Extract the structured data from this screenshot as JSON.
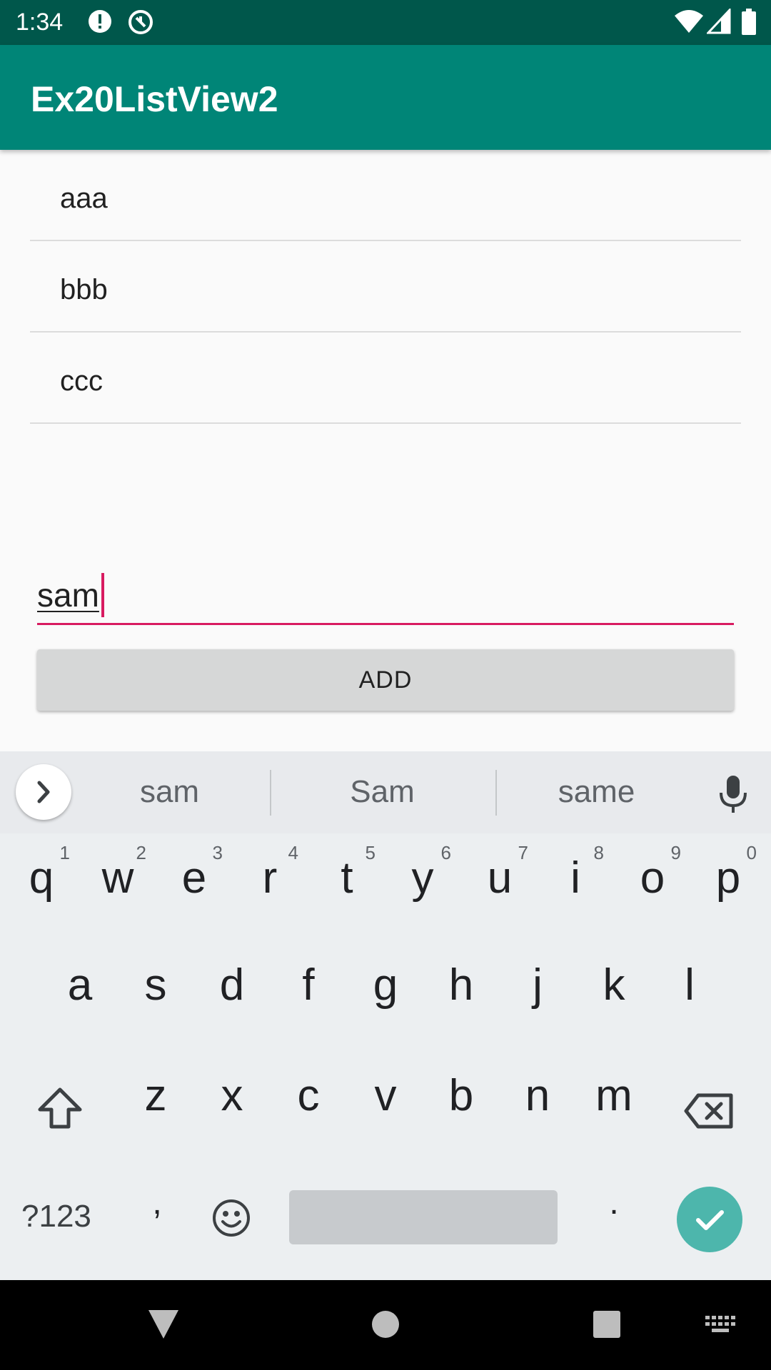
{
  "status_bar": {
    "time": "1:34"
  },
  "app_bar": {
    "title": "Ex20ListView2"
  },
  "list": {
    "items": [
      "aaa",
      "bbb",
      "ccc"
    ]
  },
  "input": {
    "value": "sam"
  },
  "add_button": {
    "label": "ADD"
  },
  "keyboard": {
    "suggestions": [
      "sam",
      "Sam",
      "same"
    ],
    "row1": [
      {
        "key": "q",
        "num": "1"
      },
      {
        "key": "w",
        "num": "2"
      },
      {
        "key": "e",
        "num": "3"
      },
      {
        "key": "r",
        "num": "4"
      },
      {
        "key": "t",
        "num": "5"
      },
      {
        "key": "y",
        "num": "6"
      },
      {
        "key": "u",
        "num": "7"
      },
      {
        "key": "i",
        "num": "8"
      },
      {
        "key": "o",
        "num": "9"
      },
      {
        "key": "p",
        "num": "0"
      }
    ],
    "row2": [
      "a",
      "s",
      "d",
      "f",
      "g",
      "h",
      "j",
      "k",
      "l"
    ],
    "row3": [
      "z",
      "x",
      "c",
      "v",
      "b",
      "n",
      "m"
    ],
    "symbols_label": "?123",
    "comma": ",",
    "period": "."
  },
  "colors": {
    "status_bar": "#00574b",
    "app_bar": "#008577",
    "accent": "#d81b60",
    "enter_key": "#4db6ac"
  }
}
